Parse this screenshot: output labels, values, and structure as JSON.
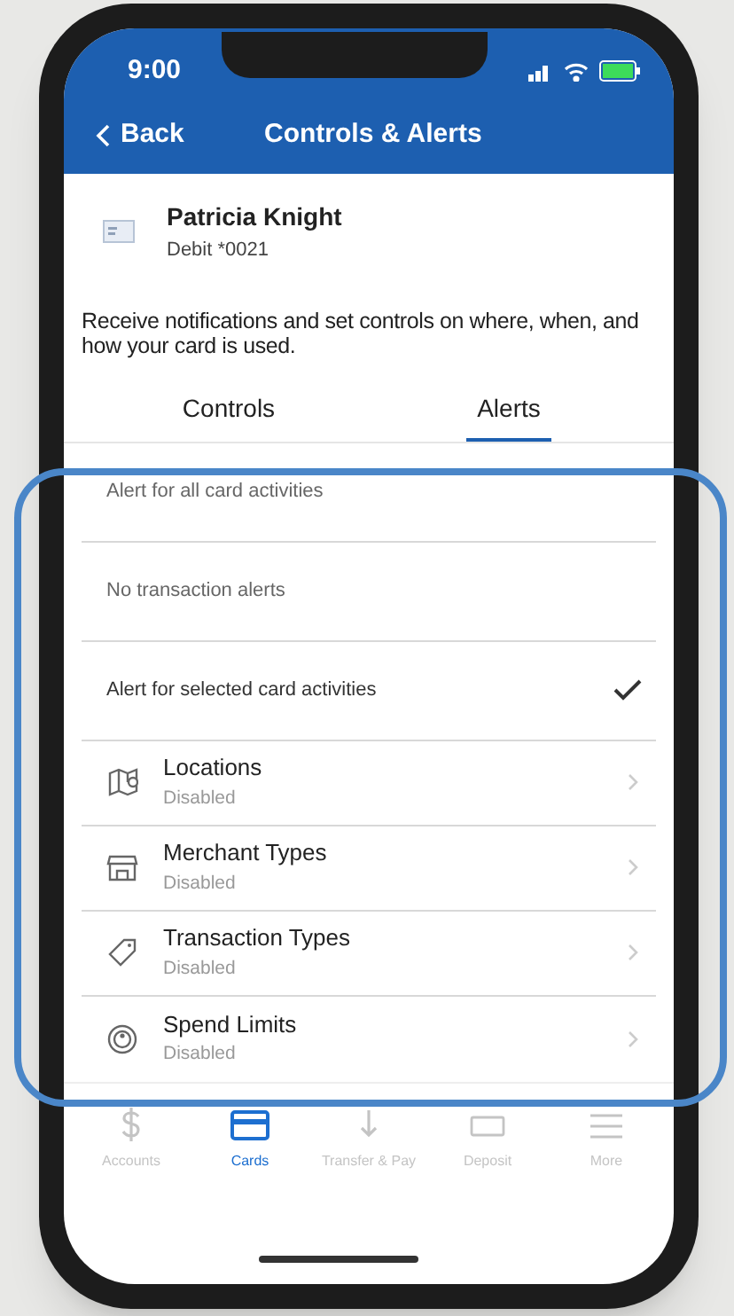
{
  "status_bar": {
    "time": "9:00"
  },
  "nav": {
    "back": "Back",
    "title": "Controls & Alerts"
  },
  "card": {
    "name": "Patricia Knight",
    "number": "Debit *0021"
  },
  "description": "Receive notifications and set controls on where, when, and how your card is used.",
  "tabs": [
    {
      "label": "Controls",
      "selected": false
    },
    {
      "label": "Alerts",
      "selected": true
    }
  ],
  "alert_options": [
    {
      "label": "Alert for all card activities",
      "selected": false
    },
    {
      "label": "No transaction alerts",
      "selected": false
    },
    {
      "label": "Alert for selected card activities",
      "selected": true
    }
  ],
  "controls": [
    {
      "kind": "map",
      "title": "Locations",
      "status": "Disabled"
    },
    {
      "kind": "store",
      "title": "Merchant Types",
      "status": "Disabled"
    },
    {
      "kind": "tag",
      "title": "Transaction Types",
      "status": "Disabled"
    },
    {
      "kind": "gauge",
      "title": "Spend Limits",
      "status": "Disabled"
    }
  ],
  "tab_bar": [
    {
      "kind": "dollar",
      "label": "Accounts",
      "selected": false
    },
    {
      "kind": "card",
      "label": "Cards",
      "selected": true
    },
    {
      "kind": "transfer",
      "label": "Transfer & Pay",
      "selected": false
    },
    {
      "kind": "deposit",
      "label": "Deposit",
      "selected": false
    },
    {
      "kind": "menu",
      "label": "More",
      "selected": false
    }
  ]
}
